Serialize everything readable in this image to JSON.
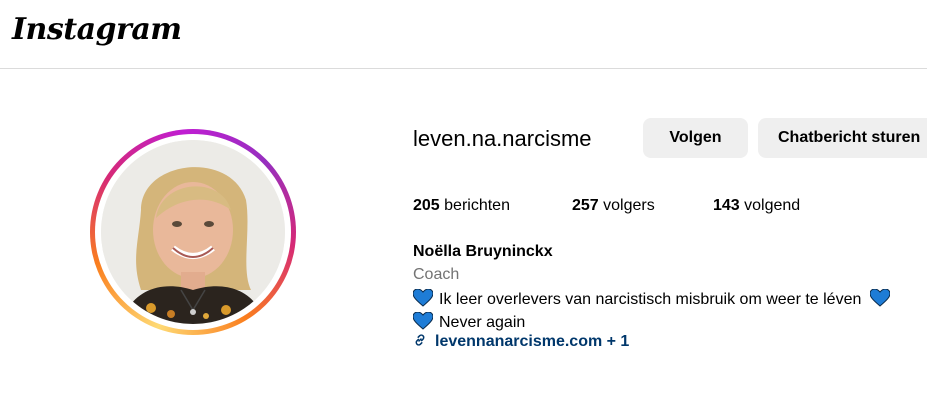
{
  "header": {
    "logo_text": "Instagram"
  },
  "profile": {
    "username": "leven.na.narcisme",
    "follow_label": "Volgen",
    "message_label": "Chatbericht sturen",
    "stats": {
      "posts_count": "205",
      "posts_label": "berichten",
      "followers_count": "257",
      "followers_label": "volgers",
      "following_count": "143",
      "following_label": "volgend"
    },
    "full_name": "Noëlla Bruyninckx",
    "category": "Coach",
    "bio_line1": "Ik leer overlevers van narcistisch misbruik om weer te léven",
    "bio_line2": "Never again",
    "link_text": "levennanarcisme.com + 1"
  },
  "colors": {
    "heart": "#1e7cd6",
    "link": "#00376b",
    "button_bg": "#efefef",
    "muted_text": "#737373"
  },
  "icons": [
    "blue-heart-icon",
    "link-icon"
  ]
}
